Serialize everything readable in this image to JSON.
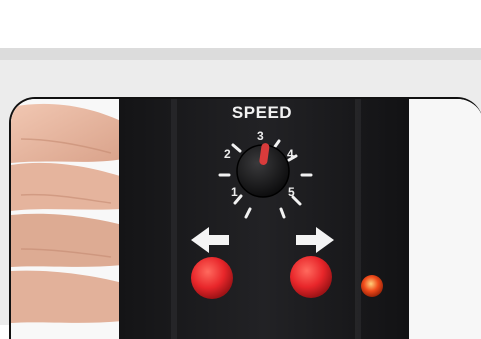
{
  "device": {
    "speed_label": "SPEED",
    "dial_numbers": [
      "1",
      "2",
      "3",
      "4",
      "5"
    ],
    "colors": {
      "body": "#1c1c1e",
      "button_red": "#e8262a",
      "led_orange": "#f04a1a",
      "knob_pointer": "#d93b3b",
      "background": "#ececec"
    },
    "icons": [
      "left-arrow-icon",
      "right-arrow-icon"
    ]
  }
}
